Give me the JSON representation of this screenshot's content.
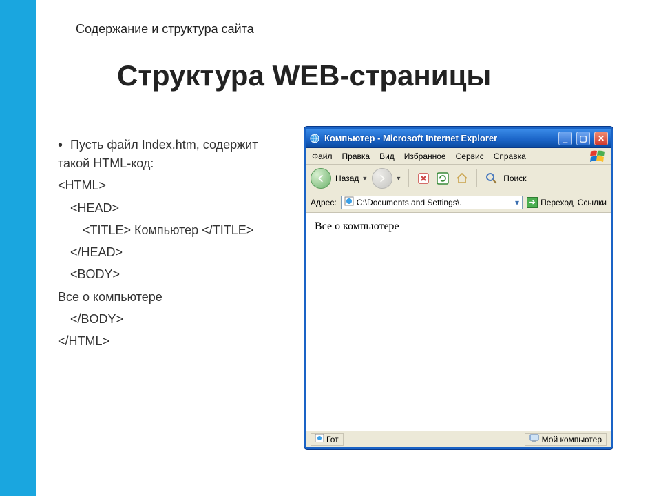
{
  "breadcrumb": "Содержание и структура сайта",
  "title": "Структура WEB-страницы",
  "bullets": {
    "intro": "Пусть  файл Index.htm, содержит такой HTML-код:",
    "l1": "<HTML>",
    "l2": "<HEAD>",
    "l3": "<TITLE> Компьютер </TITLE>",
    "l4": "</HEAD>",
    "l5": "<BODY>",
    "l6": "Все о компьютере",
    "l7": "</BODY>",
    "l8": "</HTML>"
  },
  "ie": {
    "title": "Компьютер - Microsoft Internet Explorer",
    "menu": {
      "file": "Файл",
      "edit": "Правка",
      "view": "Вид",
      "fav": "Избранное",
      "tools": "Сервис",
      "help": "Справка"
    },
    "toolbar": {
      "back": "Назад",
      "search": "Поиск"
    },
    "addr": {
      "label": "Адрес:",
      "value": "C:\\Documents and Settings\\.",
      "go": "Переход",
      "links": "Ссылки"
    },
    "body_text": "Все о компьютере",
    "status": {
      "left": "Гот",
      "right": "Мой компьютер"
    }
  }
}
